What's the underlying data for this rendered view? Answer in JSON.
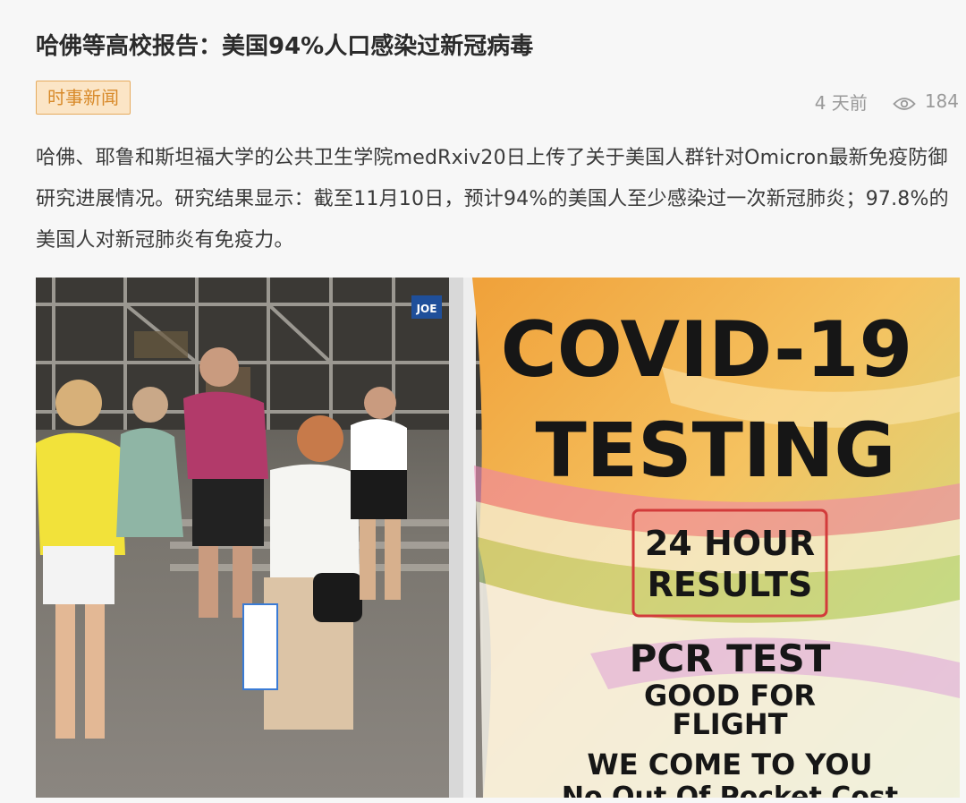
{
  "article": {
    "title": "哈佛等高校报告：美国94%人口感染过新冠病毒",
    "category_tag": "时事新闻",
    "time_ago": "4 天前",
    "view_count": "184",
    "summary": "哈佛、耶鲁和斯坦福大学的公共卫生学院medRxiv20日上传了关于美国人群针对Omicron最新免疫防御研究进展情况。研究结果显示：截至11月10日，预计94%的美国人至少感染过一次新冠肺炎；97.8%的美国人对新冠肺炎有免疫力。"
  },
  "photo": {
    "sign_lines": {
      "line1": "COVID-19",
      "line2": "TESTING",
      "box_line1": "24 HOUR",
      "box_line2": "RESULTS",
      "line3": "PCR TEST",
      "line4": "GOOD FOR",
      "line5": "FLIGHT",
      "line6": "WE COME TO YOU",
      "line7": "No Out Of Pocket Cost"
    },
    "street_sign": "JOE"
  },
  "icons": {
    "views": "eye-icon"
  },
  "colors": {
    "tag_border": "#e6ab5e",
    "tag_bg": "#fbe5c6",
    "tag_text": "#d88a2a",
    "meta_text": "#999999"
  }
}
